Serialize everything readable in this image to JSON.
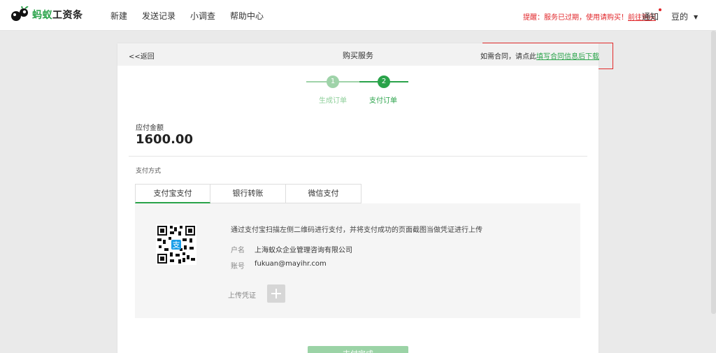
{
  "app": {
    "brand_a": "蚂蚁",
    "brand_b": "工资条"
  },
  "nav": {
    "items": [
      "新建",
      "发送记录",
      "小调查",
      "帮助中心"
    ]
  },
  "header": {
    "notice_text": "提醒：服务已过期，使用请购买！",
    "notice_link": "前往购买",
    "notify_label": "通知",
    "user_name": "豆的",
    "user_caret": "▼"
  },
  "page": {
    "back_label": "<<返回",
    "title": "购买服务",
    "contract_text": "如需合同，请点此",
    "contract_link": "填写合同信息后下载"
  },
  "steps": [
    {
      "number": "1",
      "label": "生成订单"
    },
    {
      "number": "2",
      "label": "支付订单"
    }
  ],
  "amount": {
    "label": "应付金额",
    "value": "1600.00"
  },
  "payment": {
    "label": "支付方式",
    "tabs": [
      "支付宝支付",
      "银行转账",
      "微信支付"
    ],
    "active_tab": 0,
    "description": "通过支付宝扫描左侧二维码进行支付，并将支付成功的页面截图当做凭证进行上传",
    "account_name_label": "户名",
    "account_name": "上海蚁众企业管理咨询有限公司",
    "account_no_label": "账号",
    "account_no": "fukuan@mayihr.com",
    "upload_label": "上传凭证"
  },
  "submit": {
    "label": "支付完成"
  },
  "colors": {
    "accent": "#2aa34a",
    "accent_light": "#9fd3a9",
    "alert": "#e1262a"
  }
}
